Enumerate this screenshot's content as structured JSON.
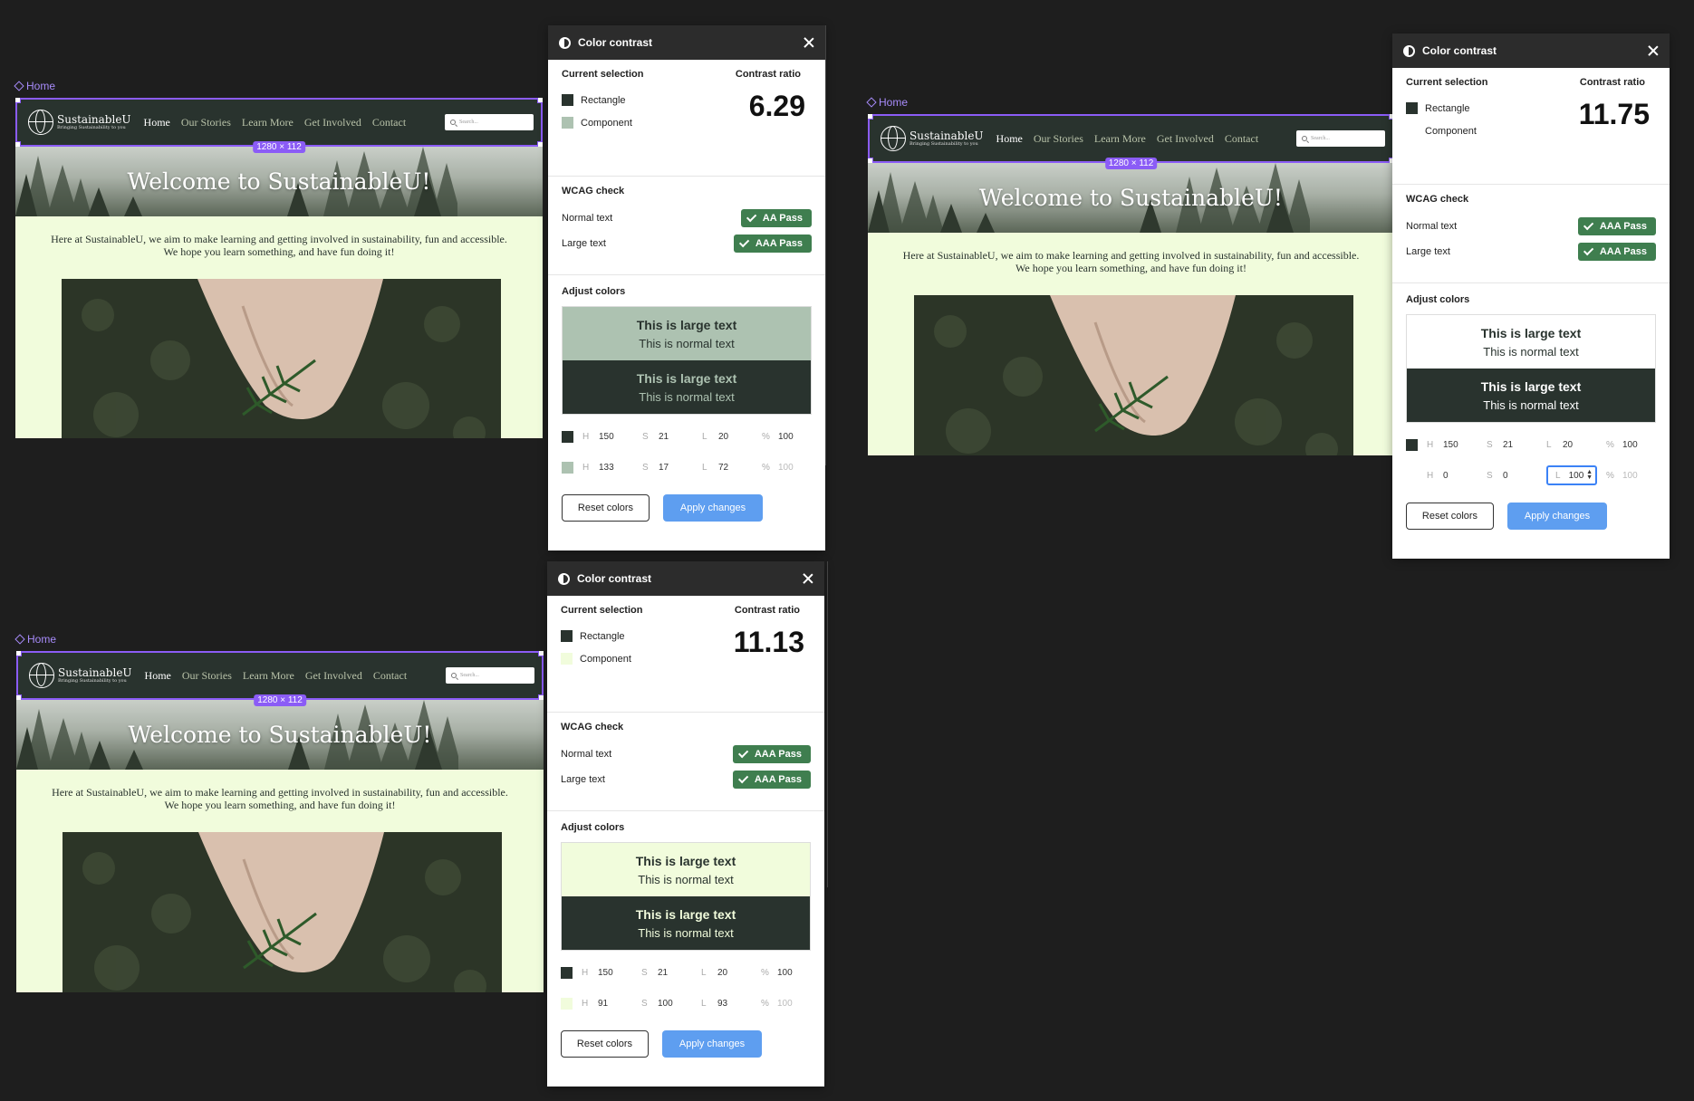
{
  "site": {
    "frame_label": "Home",
    "logo_name": "SustainableU",
    "logo_tagline": "Bringing Sustainability to you",
    "nav": [
      "Home",
      "Our Stories",
      "Learn More",
      "Get Involved",
      "Contact"
    ],
    "search_placeholder": "Search...",
    "dimension": "1280 × 112",
    "hero_title": "Welcome to SustainableU!",
    "intro_line1": "Here at SustainableU, we aim to make learning and getting involved in sustainability, fun and accessible.",
    "intro_line2": "We hope you learn something, and have fun doing it!"
  },
  "panel_common": {
    "title": "Color contrast",
    "current_selection": "Current selection",
    "contrast_ratio_label": "Contrast ratio",
    "rect_label": "Rectangle",
    "comp_label": "Component",
    "wcag_check": "WCAG check",
    "normal_text": "Normal text",
    "large_text": "Large text",
    "adjust_colors": "Adjust colors",
    "preview_large": "This is large text",
    "preview_normal": "This is normal text",
    "h": "H",
    "s": "S",
    "l": "L",
    "pct": "%",
    "reset": "Reset colors",
    "apply": "Apply changes"
  },
  "panels": [
    {
      "ratio": "6.29",
      "normal_pass": "AA Pass",
      "large_pass": "AAA Pass",
      "color1": {
        "h": "150",
        "s": "21",
        "l": "20",
        "a": "100",
        "hex": "#29332e"
      },
      "color2": {
        "h": "133",
        "s": "17",
        "l": "72",
        "a": "100",
        "hex": "#adc2b1"
      }
    },
    {
      "ratio": "11.75",
      "normal_pass": "AAA Pass",
      "large_pass": "AAA Pass",
      "color1": {
        "h": "150",
        "s": "21",
        "l": "20",
        "a": "100",
        "hex": "#29332e"
      },
      "color2": {
        "h": "0",
        "s": "0",
        "l": "100",
        "a": "100",
        "hex": "#ffffff"
      }
    },
    {
      "ratio": "11.13",
      "normal_pass": "AAA Pass",
      "large_pass": "AAA Pass",
      "color1": {
        "h": "150",
        "s": "21",
        "l": "20",
        "a": "100",
        "hex": "#29332e"
      },
      "color2": {
        "h": "91",
        "s": "100",
        "l": "93",
        "a": "100",
        "hex": "#f1fcdc"
      }
    }
  ]
}
